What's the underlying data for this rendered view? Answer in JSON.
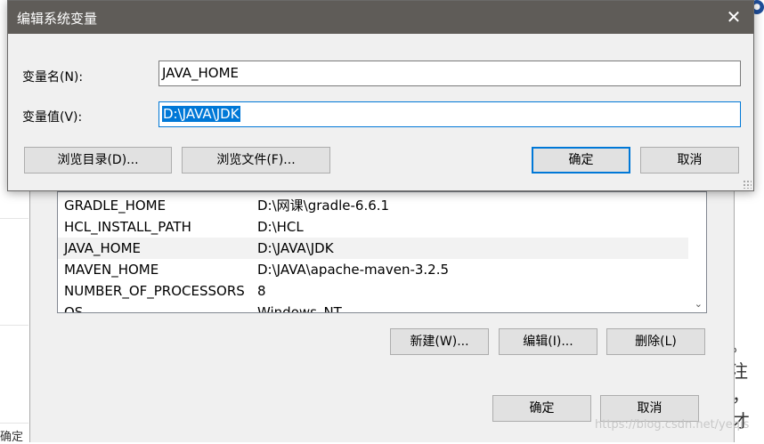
{
  "dialog": {
    "title": "编辑系统变量",
    "name_label": "变量名(N):",
    "name_value": "JAVA_HOME",
    "value_label": "变量值(V):",
    "value_value": "D:\\JAVA\\JDK",
    "browse_dir": "浏览目录(D)...",
    "browse_file": "浏览文件(F)...",
    "ok": "确定",
    "cancel": "取消"
  },
  "parent": {
    "rows": [
      {
        "name": "GRADLE_HOME",
        "value": "D:\\网课\\gradle-6.6.1"
      },
      {
        "name": "HCL_INSTALL_PATH",
        "value": "D:\\HCL"
      },
      {
        "name": "JAVA_HOME",
        "value": "D:\\JAVA\\JDK"
      },
      {
        "name": "MAVEN_HOME",
        "value": "D:\\JAVA\\apache-maven-3.2.5"
      },
      {
        "name": "NUMBER_OF_PROCESSORS",
        "value": "8"
      },
      {
        "name": "OS",
        "value": "Windows_NT"
      }
    ],
    "new_btn": "新建(W)...",
    "edit_btn": "编辑(I)...",
    "delete_btn": "删除(L)",
    "ok": "确定",
    "cancel": "取消"
  },
  "background": {
    "left_text": "确定",
    "right_text1": "。注",
    "right_text2": "，才"
  },
  "watermark": "https://blog.csdn.net/yeqis"
}
